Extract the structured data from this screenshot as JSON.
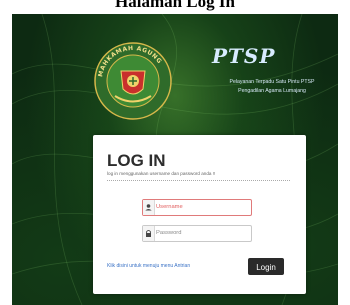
{
  "caption": "Halaman Log In",
  "emblem": {
    "name": "Mahkamah Agung emblem",
    "ring_text": "MAHKAMAH AGUNG"
  },
  "brand": {
    "logo_text": "PTSP",
    "subtitle_line1": "Pelayanan Terpadu Satu Pintu PTSP",
    "subtitle_line2": "Pengadilan Agama Lumajang"
  },
  "login": {
    "title": "LOG IN",
    "subtitle": "log in menggunakan username dan password anda !!",
    "username_placeholder": "Username",
    "password_placeholder": "Password",
    "antrian_link": "Klik disini untuk menuju menu Antrian",
    "login_button": "Login"
  },
  "colors": {
    "background": "#0d2a12",
    "card": "#ffffff",
    "button": "#2a2a2a",
    "link": "#3b73c6",
    "username_border": "#e07a7a"
  },
  "icons": {
    "username": "user-icon",
    "password": "lock-icon"
  }
}
